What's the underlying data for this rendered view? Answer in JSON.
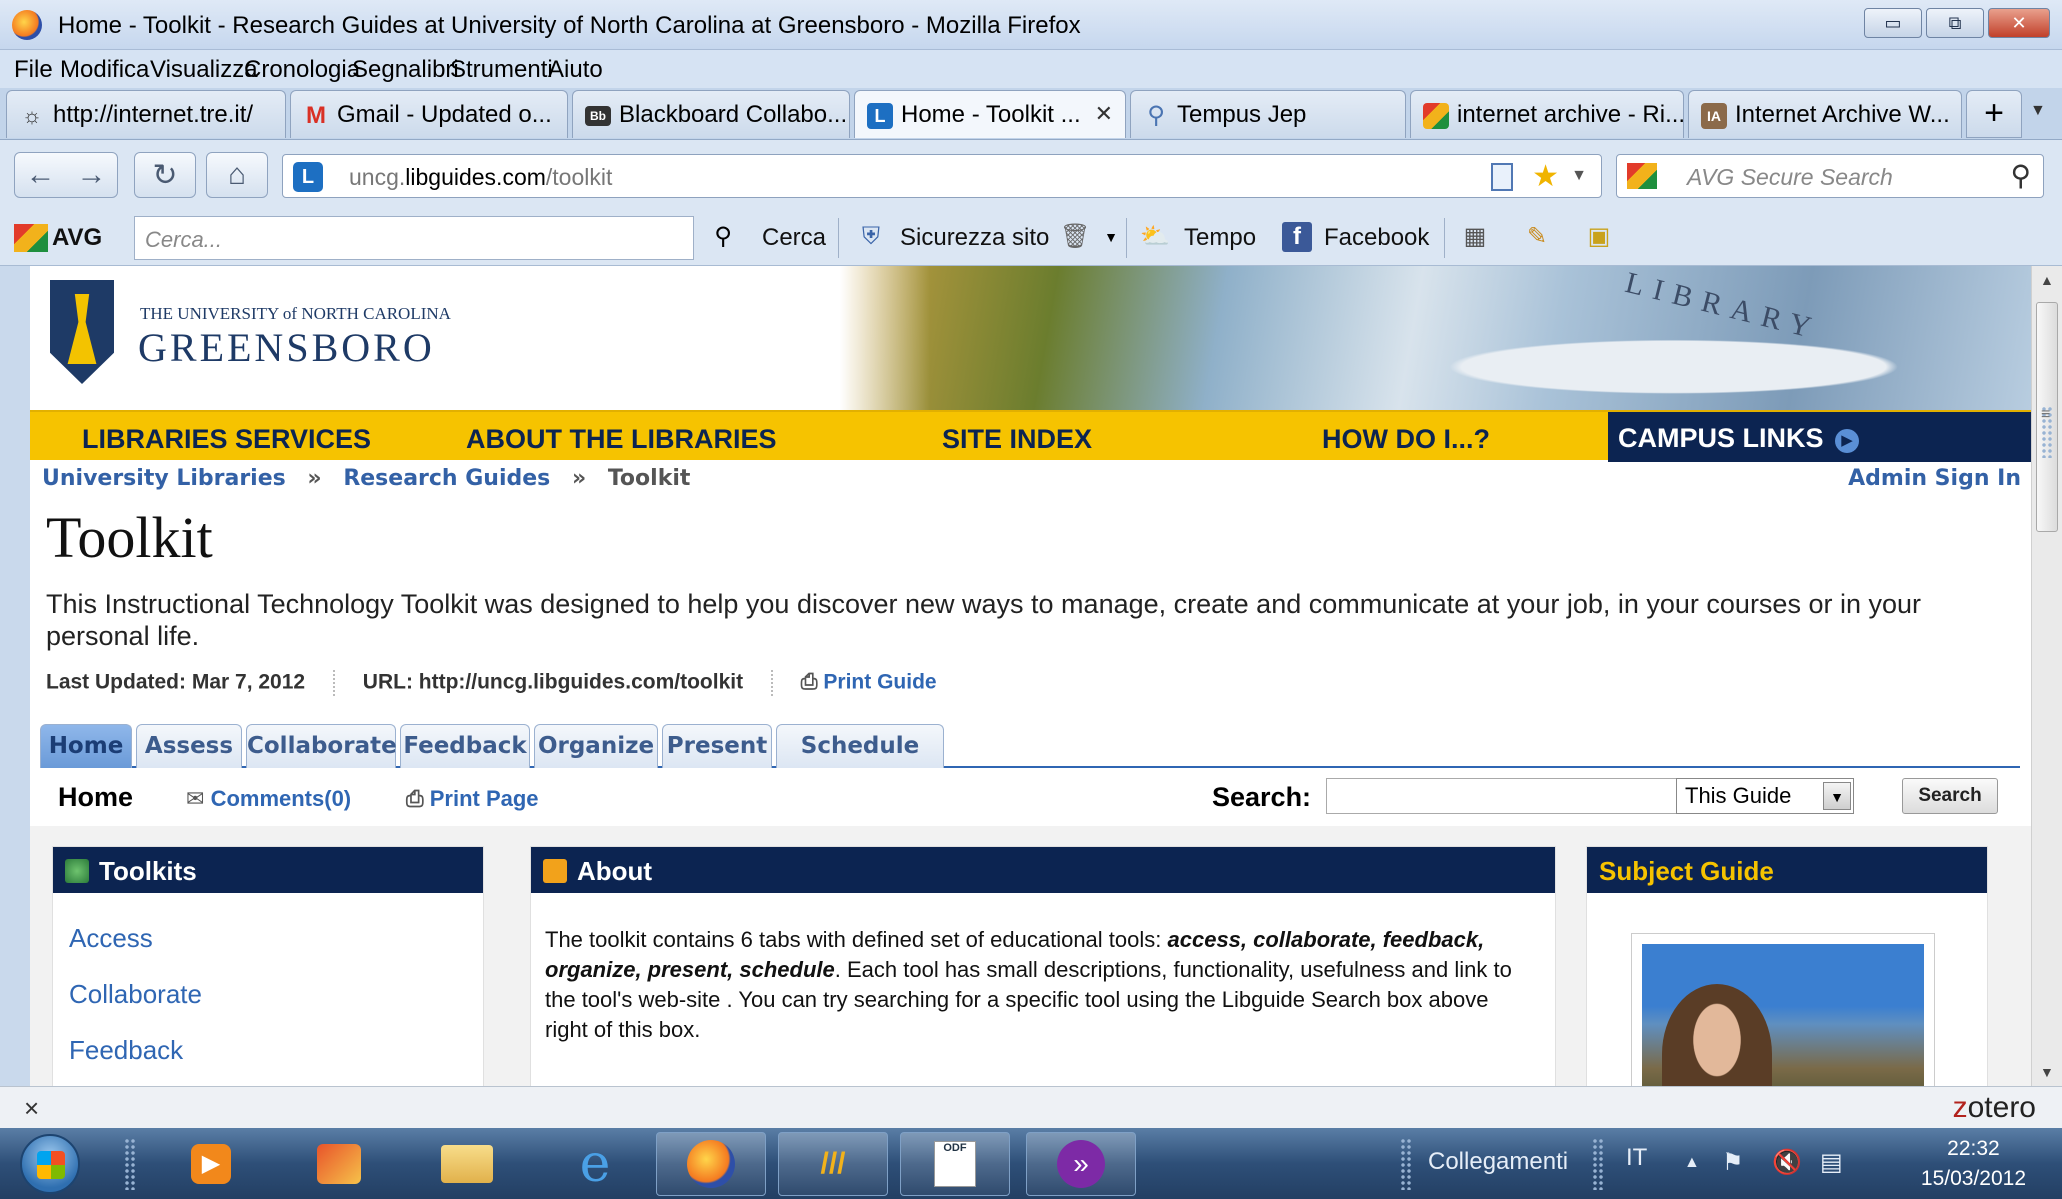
{
  "window": {
    "title": "Home - Toolkit - Research Guides at University of North Carolina at Greensboro - Mozilla Firefox",
    "controls": [
      "▭",
      "⧉",
      "✕"
    ]
  },
  "menu": [
    "File",
    "Modifica",
    "Visualizza",
    "Cronologia",
    "Segnalibri",
    "Strumenti",
    "Aiuto"
  ],
  "tabs": [
    {
      "label": "http://internet.tre.it/",
      "icon": "tre-icon"
    },
    {
      "label": "Gmail - Updated o...",
      "icon": "gmail-icon"
    },
    {
      "label": "Blackboard Collabo...",
      "icon": "blackboard-icon"
    },
    {
      "label": "Home - Toolkit ...",
      "icon": "libguides-icon",
      "active": true
    },
    {
      "label": "Tempus Jep",
      "icon": "search-icon"
    },
    {
      "label": "internet archive - Ri...",
      "icon": "avg-icon"
    },
    {
      "label": "Internet Archive W...",
      "icon": "archive-icon"
    }
  ],
  "newtab_label": "+",
  "address": {
    "prefix": "uncg.",
    "domain": "libguides.com",
    "path": "/toolkit"
  },
  "search_engine": {
    "placeholder": "AVG Secure Search"
  },
  "avg_toolbar": {
    "brand": "AVG",
    "search_placeholder": "Cerca...",
    "search_label": "Cerca",
    "safety_label": "Sicurezza sito",
    "weather_label": "Tempo",
    "facebook_label": "Facebook"
  },
  "site": {
    "university_line1": "THE UNIVERSITY of NORTH CAROLINA",
    "university_line2": "GREENSBORO",
    "library_word": "LIBRARY",
    "nav": [
      "LIBRARIES SERVICES",
      "ABOUT THE LIBRARIES",
      "SITE INDEX",
      "HOW DO I...?"
    ],
    "campus_links": "CAMPUS LINKS",
    "breadcrumb": [
      "University Libraries",
      "Research Guides",
      "Toolkit"
    ],
    "breadcrumb_sep": "»",
    "admin": "Admin Sign In",
    "title": "Toolkit",
    "description": "This Instructional Technology Toolkit was designed to help you discover new ways to manage, create and communicate at your job, in your courses or in your personal life.",
    "last_updated": "Last Updated: Mar 7, 2012",
    "url": "URL: http://uncg.libguides.com/toolkit",
    "print_guide": "Print Guide",
    "guide_tabs": [
      "Home",
      "Assess",
      "Collaborate",
      "Feedback",
      "Organize",
      "Present",
      "Schedule"
    ],
    "page_heading": "Home",
    "comments": "Comments(0)",
    "print_page": "Print Page",
    "search_label": "Search:",
    "search_scope": "This Guide",
    "search_button": "Search",
    "boxes": {
      "toolkits": {
        "title": "Toolkits",
        "items": [
          "Access",
          "Collaborate",
          "Feedback"
        ]
      },
      "about": {
        "title": "About",
        "text_a": "The toolkit contains 6 tabs with defined set of educational tools: ",
        "text_b": "access, collaborate, feedback, organize, present, schedule",
        "text_c": ". Each tool has small descriptions, functionality, usefulness and link to the tool's web-site .  You can try searching for a specific tool using the Libguide Search box above right of this box."
      },
      "subject": {
        "title": "Subject Guide"
      }
    }
  },
  "zotero": {
    "close": "×",
    "label_z": "z",
    "label_rest": "otero"
  },
  "taskbar": {
    "links": "Collegamenti",
    "lang": "IT",
    "time": "22:32",
    "date": "15/03/2012"
  }
}
